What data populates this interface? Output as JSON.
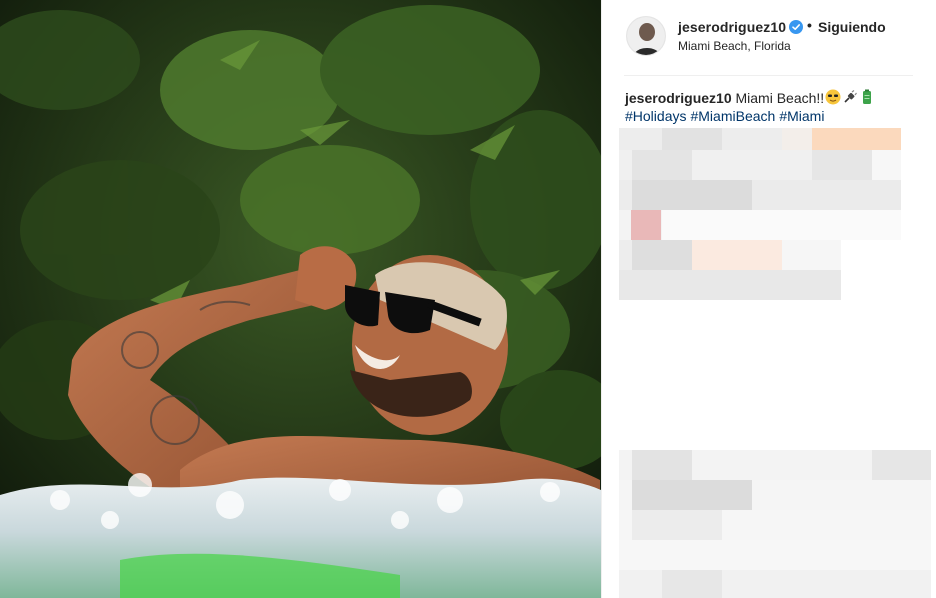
{
  "post": {
    "username": "jeserodriguez10",
    "separator": "•",
    "follow_status": "Siguiendo",
    "location": "Miami Beach, Florida",
    "verified_icon": "verified-badge-icon",
    "caption": {
      "username": "jeserodriguez10",
      "text": "Miami Beach!!",
      "emojis": [
        "sunglasses-emoji-icon",
        "plug-emoji-icon",
        "battery-emoji-icon"
      ],
      "hashtags": [
        "#Holidays",
        "#MiamiBeach",
        "#Miami"
      ]
    }
  },
  "colors": {
    "link": "#003569",
    "verified": "#3897f0",
    "border": "#efefef",
    "text": "#262626"
  }
}
